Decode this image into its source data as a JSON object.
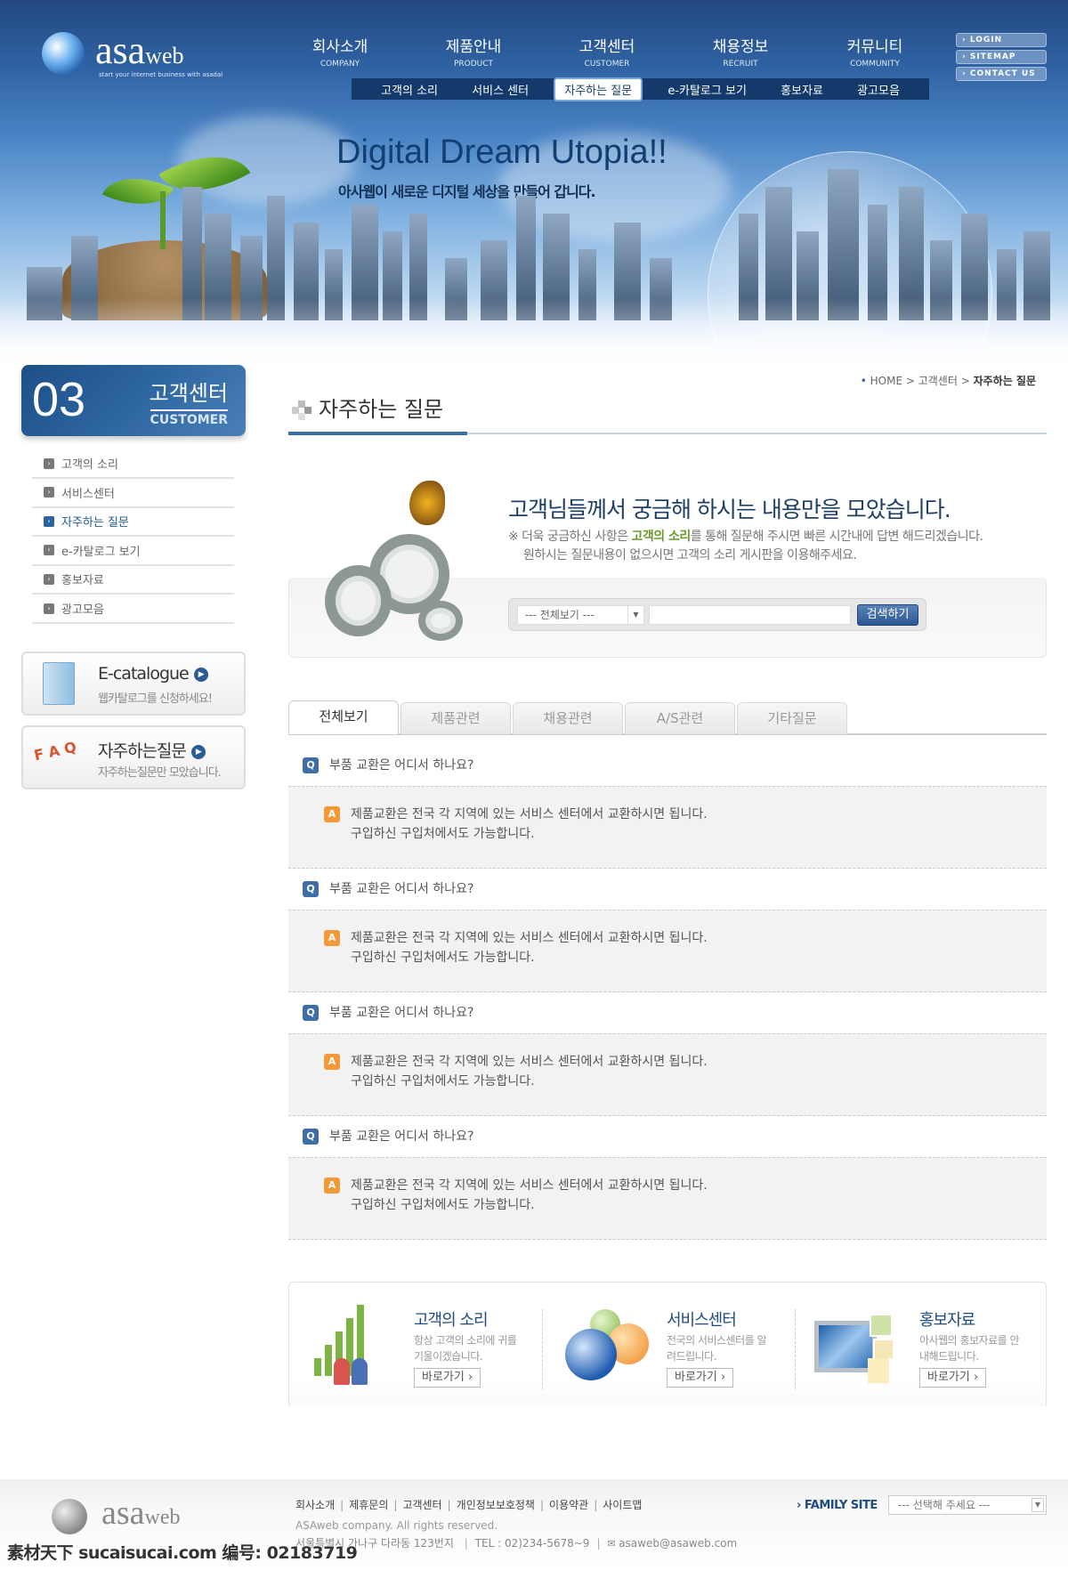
{
  "brand": {
    "logo_text": "asa",
    "logo_suffix": "web",
    "tagline": "start your internet business with asadal"
  },
  "nav": [
    {
      "ko": "회사소개",
      "en": "COMPANY"
    },
    {
      "ko": "제품안내",
      "en": "PRODUCT"
    },
    {
      "ko": "고객센터",
      "en": "CUSTOMER"
    },
    {
      "ko": "채용정보",
      "en": "RECRUIT"
    },
    {
      "ko": "커뮤니티",
      "en": "COMMUNITY"
    }
  ],
  "subnav": [
    "고객의 소리",
    "서비스 센터",
    "자주하는 질문",
    "e-카탈로그 보기",
    "홍보자료",
    "광고모음"
  ],
  "subnav_active": 2,
  "util": [
    "LOGIN",
    "SITEMAP",
    "CONTACT US"
  ],
  "hero": {
    "title": "Digital Dream Utopia!!",
    "subtitle": "아사웹이 새로운 디지털 세상을 만들어 갑니다."
  },
  "sidebar": {
    "number": "03",
    "title": "고객센터",
    "subtitle": "CUSTOMER",
    "items": [
      "고객의 소리",
      "서비스센터",
      "자주하는 질문",
      "e-카탈로그 보기",
      "홍보자료",
      "광고모음"
    ],
    "active": 2,
    "promos": [
      {
        "title": "E-catalogue",
        "desc": "웹카탈로그를 신청하세요!",
        "icon": "folder-icon"
      },
      {
        "title": "자주하는질문",
        "desc": "자주하는질문만 모았습니다.",
        "icon": "faq-book-icon"
      }
    ]
  },
  "breadcrumb": {
    "home": "HOME",
    "section": "고객센터",
    "current": "자주하는 질문"
  },
  "page_title": "자주하는 질문",
  "intro": {
    "heading": "고객님들께서 궁금해 하시는 내용만을 모았습니다.",
    "note1_pre": "※ 더욱 궁금하신 사항은 ",
    "note1_link": "고객의 소리",
    "note1_post": "를 통해 질문해 주시면 빠른 시간내에 답변 해드리겠습니다.",
    "note2": "원하시는 질문내용이 없으시면 고객의 소리 게시판을 이용해주세요."
  },
  "search": {
    "select_value": "--- 전체보기 ---",
    "input_value": "",
    "button": "검색하기"
  },
  "tabs": [
    "전체보기",
    "제품관련",
    "채용관련",
    "A/S관련",
    "기타질문"
  ],
  "tab_active": 0,
  "faq": [
    {
      "q": "부품 교환은 어디서 하나요?",
      "a1": "제품교환은 전국 각 지역에 있는 서비스 센터에서 교환하시면 됩니다.",
      "a2": "구입하신 구입처에서도 가능합니다."
    },
    {
      "q": "부품 교환은 어디서 하나요?",
      "a1": "제품교환은 전국 각 지역에 있는 서비스 센터에서 교환하시면 됩니다.",
      "a2": "구입하신 구입처에서도 가능합니다."
    },
    {
      "q": "부품 교환은 어디서 하나요?",
      "a1": "제품교환은 전국 각 지역에 있는 서비스 센터에서 교환하시면 됩니다.",
      "a2": "구입하신 구입처에서도 가능합니다."
    },
    {
      "q": "부품 교환은 어디서 하나요?",
      "a1": "제품교환은 전국 각 지역에 있는 서비스 센터에서 교환하시면 됩니다.",
      "a2": "구입하신 구입처에서도 가능합니다."
    }
  ],
  "badges": {
    "q": "Q",
    "a": "A"
  },
  "banners": [
    {
      "title": "고객의 소리",
      "desc": "항상 고객의 소리에 귀를 기울이겠습니다.",
      "go": "바로가기 ›"
    },
    {
      "title": "서비스센터",
      "desc": "전국의 서비스센터를 알려드립니다.",
      "go": "바로가기 ›"
    },
    {
      "title": "홍보자료",
      "desc": "아사웹의 홍보자료를 안내해드립니다.",
      "go": "바로가기 ›"
    }
  ],
  "footer": {
    "links": [
      "회사소개",
      "제휴문의",
      "고객센터",
      "개인정보보호정책",
      "이용약관",
      "사이트맵"
    ],
    "copyright": "ASAweb company. All rights reserved.",
    "address": "서울특별시 가나구 다라동 123번지",
    "tel": "TEL : 02)234-5678~9",
    "email": "asaweb@asaweb.com",
    "family_label": "FAMILY SITE",
    "family_select": "--- 선택해 주세요 ---"
  },
  "watermark": "素材天下 sucaisucai.com  编号: 02183719",
  "colors": {
    "primary": "#2b63a0",
    "nav_dark": "#133a6b",
    "accent_green": "#6a9a2a",
    "answer_badge": "#f29a3a"
  }
}
